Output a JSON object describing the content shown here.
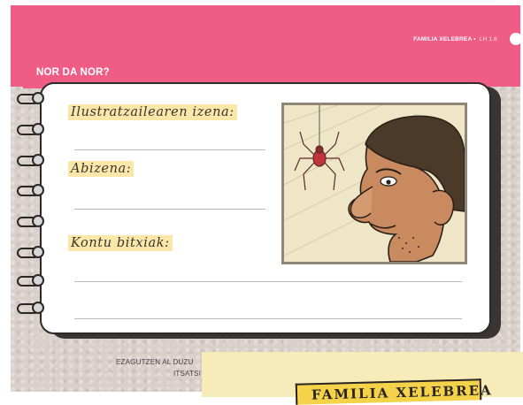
{
  "header": {
    "series": "FAMILIA XELEBREA",
    "separator": "•",
    "page_ref": "LH 1.6"
  },
  "section": {
    "title": "NOR DA NOR?"
  },
  "form": {
    "field_name_label": "Ilustratzailearen izena:",
    "field_surname_label": "Abizena:",
    "field_facts_label": "Kontu bitxiak:"
  },
  "portrait": {
    "icon": "illustration-man-with-spider",
    "colors": {
      "background": "#efe6c8",
      "frame": "#8d8679",
      "skin": "#c98a5f",
      "hair": "#4b3a2a",
      "spider": "#c2353a"
    }
  },
  "footer": {
    "caption_line1": "EZAGUTZEN AL DUZU",
    "caption_line2": "ITSATSI",
    "cover_title": "FAMILIA XELEBREA"
  },
  "colors": {
    "accent": "#ef5d86",
    "highlight": "#fbe7a8",
    "background": "#d9cfc9"
  }
}
